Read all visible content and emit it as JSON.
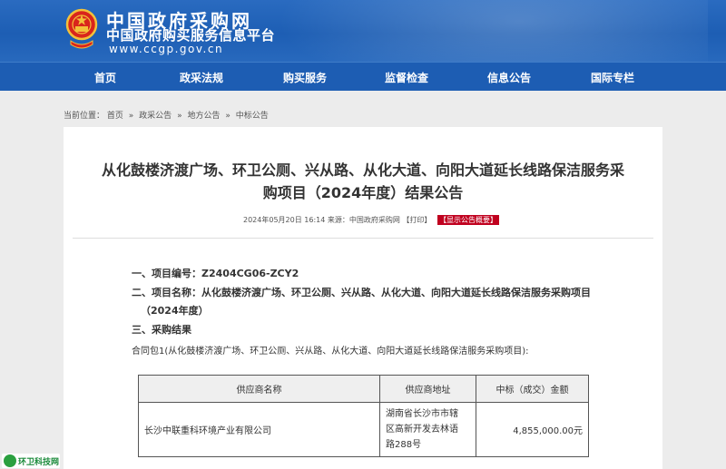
{
  "header": {
    "title": "中国政府采购网",
    "subtitle": "中国政府购买服务信息平台",
    "url": "www.ccgp.gov.cn",
    "colors": {
      "header_blue": "#1d5eb4",
      "nav_blue": "#1d5db3",
      "accent_red": "#c0001f"
    }
  },
  "nav": {
    "items": [
      {
        "label": "首页"
      },
      {
        "label": "政采法规"
      },
      {
        "label": "购买服务"
      },
      {
        "label": "监督检查"
      },
      {
        "label": "信息公告"
      },
      {
        "label": "国际专栏"
      }
    ]
  },
  "breadcrumb": {
    "prefix": "当前位置：",
    "items": [
      "首页",
      "政采公告",
      "地方公告",
      "中标公告"
    ],
    "separator": "»"
  },
  "article": {
    "title_line1": "从化鼓楼济渡广场、环卫公厕、兴从路、从化大道、向阳大道延长线路保洁服务采",
    "title_line2": "购项目（2024年度）结果公告",
    "date": "2024年05月20日 16:14",
    "source": "来源：中国政府采购网",
    "print": "【打印】",
    "summary": "【显示公告概要】",
    "sections": {
      "project_no_label": "一、项目编号：",
      "project_no": "Z2404CG06-ZCY2",
      "project_name_label": "二、项目名称：",
      "project_name": "从化鼓楼济渡广场、环卫公厕、兴从路、从化大道、向阳大道延长线路保洁服务采购项目",
      "project_name_cont": "（2024年度）",
      "result_label": "三、采购结果"
    },
    "package_intro": "合同包1(从化鼓楼济渡广场、环卫公厕、兴从路、从化大道、向阳大道延长线路保洁服务采购项目):",
    "table": {
      "headers": [
        "供应商名称",
        "供应商地址",
        "中标（成交）金额"
      ],
      "rows": [
        {
          "name": "长沙中联重科环境产业有限公司",
          "address_lines": [
            "湖南省长沙市市辖",
            "区高新开发去林语",
            "路288号"
          ],
          "amount": "4,855,000.00元"
        }
      ]
    }
  },
  "watermark": {
    "text": "环卫科技网"
  }
}
